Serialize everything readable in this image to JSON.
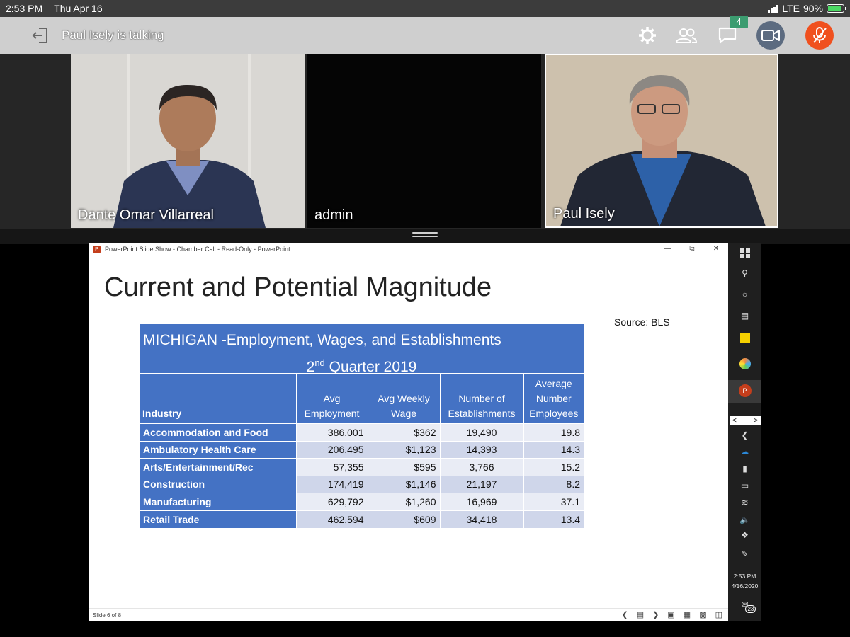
{
  "status_bar": {
    "time": "2:53 PM",
    "date": "Thu Apr 16",
    "network": "LTE",
    "battery": "90%",
    "battery_level": 0.9
  },
  "toolbar": {
    "talking_text": "Paul Isely is talking",
    "chat_badge": "4",
    "icons": [
      "leave-icon",
      "gear-icon",
      "participants-icon",
      "chat-icon",
      "camera-icon",
      "mic-muted-icon"
    ],
    "mic_color": "#f0501e",
    "camera_color": "#5c6b80"
  },
  "participants": [
    {
      "name": "Dante Omar Villarreal"
    },
    {
      "name": "admin"
    },
    {
      "name": "Paul Isely"
    }
  ],
  "powerpoint": {
    "window_title": "PowerPoint Slide Show  -  Chamber Call  -  Read-Only  -  PowerPoint",
    "slide_indicator": "Slide 6 of 8"
  },
  "slide": {
    "title": "Current and Potential Magnitude",
    "source": "Source: BLS",
    "table_title_line1": "MICHIGAN -Employment, Wages, and Establishments",
    "table_title_ordinal": "2",
    "table_title_sup": "nd",
    "table_title_rest": " Quarter 2019",
    "headers": {
      "industry": "Industry",
      "avg_emp_1": "Avg",
      "avg_emp_2": "Employment",
      "wage_1": "Avg Weekly",
      "wage_2": "Wage",
      "est_1": "Number of",
      "est_2": "Establishments",
      "ane_1": "Average",
      "ane_2": "Number",
      "ane_3": "Employees"
    },
    "rows": [
      {
        "industry": "Accommodation and Food",
        "employment": "386,001",
        "wage": "$362",
        "establishments": "19,490",
        "avg_employees": "19.8"
      },
      {
        "industry": "Ambulatory Health Care",
        "employment": "206,495",
        "wage": "$1,123",
        "establishments": "14,393",
        "avg_employees": "14.3"
      },
      {
        "industry": "Arts/Entertainment/Rec",
        "employment": "57,355",
        "wage": "$595",
        "establishments": "3,766",
        "avg_employees": "15.2"
      },
      {
        "industry": "Construction",
        "employment": "174,419",
        "wage": "$1,146",
        "establishments": "21,197",
        "avg_employees": "8.2"
      },
      {
        "industry": "Manufacturing",
        "employment": "629,792",
        "wage": "$1,260",
        "establishments": "16,969",
        "avg_employees": "37.1"
      },
      {
        "industry": "Retail Trade",
        "employment": "462,594",
        "wage": "$609",
        "establishments": "34,418",
        "avg_employees": "13.4"
      }
    ]
  },
  "taskbar": {
    "time": "2:53 PM",
    "date": "4/16/2020",
    "notification_count": "23"
  }
}
